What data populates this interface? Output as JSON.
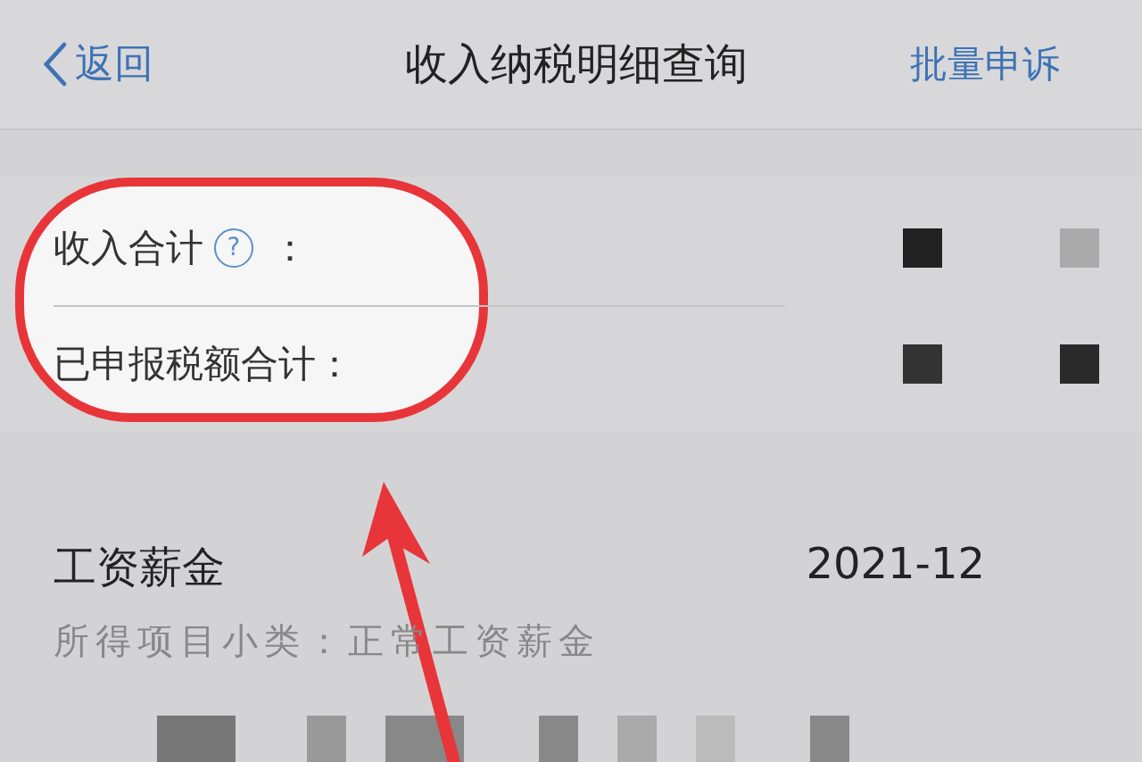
{
  "nav": {
    "back": "返回",
    "title": "收入纳税明细查询",
    "action": "批量申诉"
  },
  "summary": [
    {
      "label": "收入合计",
      "help_icon": "?",
      "colon": "："
    },
    {
      "label": "已申报税额合计："
    }
  ],
  "records": [
    {
      "title": "工资薪金",
      "date": "2021-12",
      "subtitle": "所得项目小类：正常工资薪金"
    }
  ]
}
